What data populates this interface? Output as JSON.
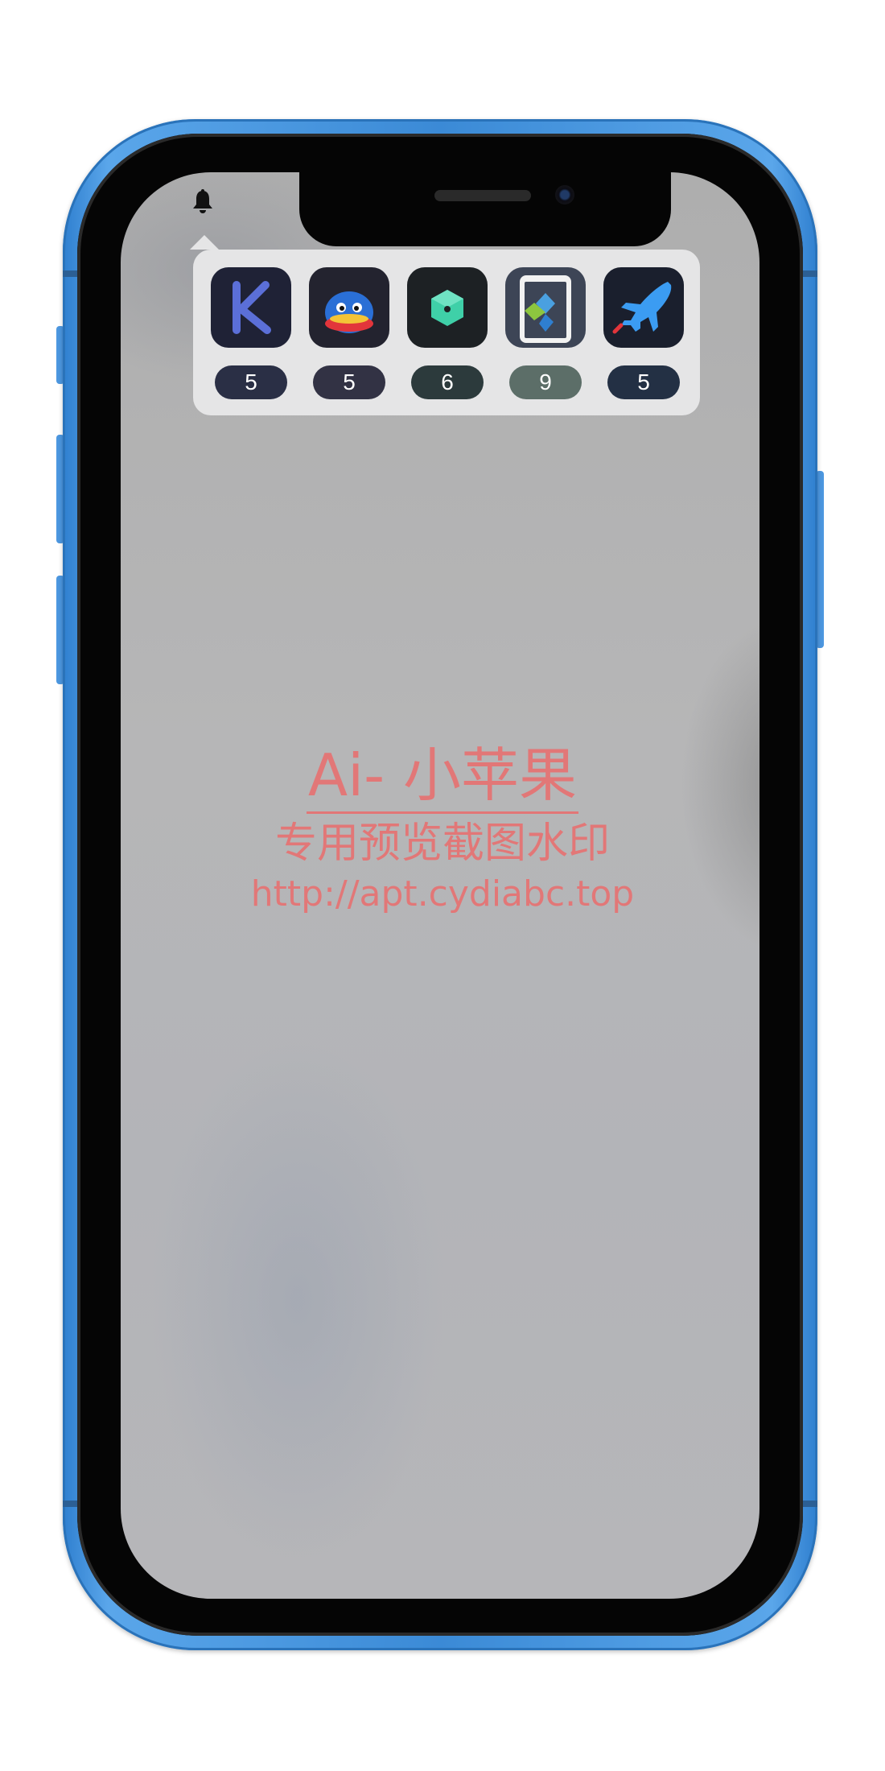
{
  "notification_popup": {
    "bell_icon": "bell-icon",
    "apps": [
      {
        "icon": "k-letter-icon",
        "badge": "5",
        "badge_color": "#2a2f45",
        "icon_bg": "#1f2236"
      },
      {
        "icon": "qq-penguin-icon",
        "badge": "5",
        "badge_color": "#323244",
        "icon_bg": "#23232f"
      },
      {
        "icon": "green-cube-icon",
        "badge": "6",
        "badge_color": "#2c3a3c",
        "icon_bg": "#1d2124"
      },
      {
        "icon": "phone-cube-icon",
        "badge": "9",
        "badge_color": "#5c6e68",
        "icon_bg": "#3d4556"
      },
      {
        "icon": "airplane-icon",
        "badge": "5",
        "badge_color": "#233044",
        "icon_bg": "#1a1f2d"
      }
    ]
  },
  "watermark": {
    "line1": "Ai- 小苹果",
    "line2": "专用预览截图水印",
    "line3": "http://apt.cydiabc.top"
  },
  "colors": {
    "phone_frame": "#3b8ad6",
    "screen_background": "#b3b4b8",
    "watermark_text": "#e86e6e"
  }
}
